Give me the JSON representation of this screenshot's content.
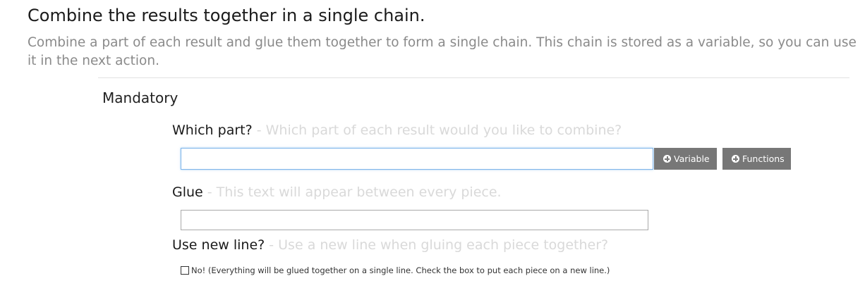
{
  "header": {
    "title": "Combine the results together in a single chain.",
    "description": "Combine a part of each result and glue them together to form a single chain. This chain is stored as a variable, so you can use it in the next action."
  },
  "section": {
    "title": "Mandatory"
  },
  "fields": {
    "which_part": {
      "label": "Which part?",
      "hint": " - Which part of each result would you like to combine?",
      "value": ""
    },
    "glue": {
      "label": "Glue",
      "hint": " - This text will appear between every piece.",
      "value": ""
    },
    "new_line": {
      "label": "Use new line?",
      "hint": " - Use a new line when gluing each piece together?",
      "checkbox_label": "No! (Everything will be glued together on a single line. Check the box to put each piece on a new line.)",
      "checked": false
    }
  },
  "buttons": {
    "variable_label": "Variable",
    "functions_label": "Functions",
    "icon": "circle-plus-icon"
  },
  "colors": {
    "button_bg": "#777777",
    "hint_text": "#d9d9d9",
    "description_text": "#8a8a8a",
    "focus_border": "#7eb4ea"
  }
}
